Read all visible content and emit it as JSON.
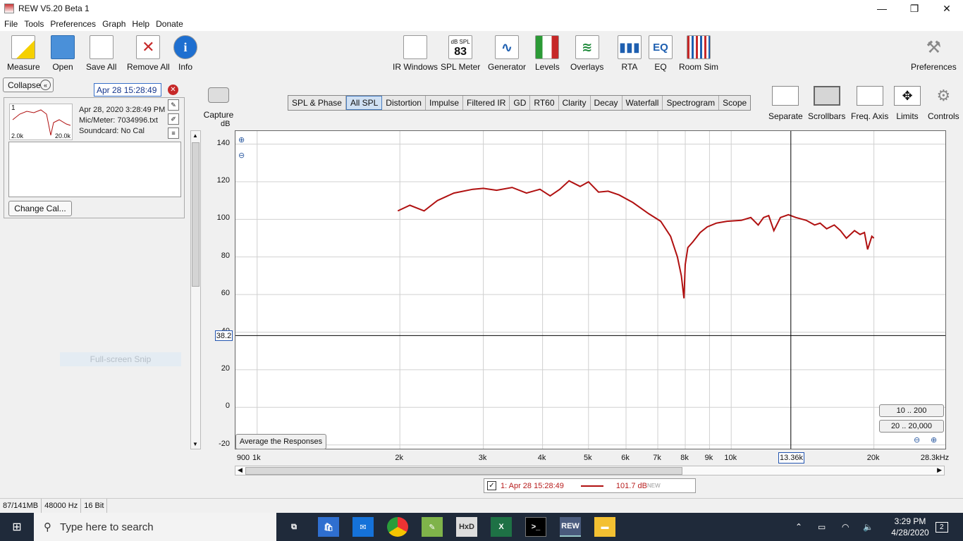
{
  "window": {
    "title": "REW V5.20 Beta 1",
    "minimize": "—",
    "maximize": "❐",
    "close": "✕"
  },
  "menu": [
    "File",
    "Tools",
    "Preferences",
    "Graph",
    "Help",
    "Donate"
  ],
  "toolbar_left": [
    "Measure",
    "Open",
    "Save All",
    "Remove All",
    "Info"
  ],
  "toolbar_center": [
    {
      "label": "IR Windows",
      "icon": "ir-windows-icon"
    },
    {
      "label": "SPL Meter",
      "icon": "spl-meter-icon",
      "badge_top": "dB SPL",
      "badge_value": "83"
    },
    {
      "label": "Generator",
      "icon": "generator-icon"
    },
    {
      "label": "Levels",
      "icon": "levels-icon"
    },
    {
      "label": "Overlays",
      "icon": "overlays-icon"
    },
    {
      "label": "RTA",
      "icon": "rta-icon"
    },
    {
      "label": "EQ",
      "icon": "eq-icon"
    },
    {
      "label": "Room Sim",
      "icon": "room-sim-icon"
    }
  ],
  "toolbar_right": "Preferences",
  "left_panel": {
    "collapse_label": "Collapse",
    "measurement_name": "Apr 28 15:28:49",
    "thumb_number": "1",
    "thumb_lo": "2.0k",
    "thumb_hi": "20.0k",
    "date": "Apr 28, 2020 3:28:49 PM",
    "mic": "Mic/Meter: 7034996.txt",
    "soundcard": "Soundcard: No Cal",
    "change_cal": "Change Cal...",
    "snip_text": "Full-screen Snip"
  },
  "capture_label": "Capture",
  "graph_tabs": [
    "SPL & Phase",
    "All SPL",
    "Distortion",
    "Impulse",
    "Filtered IR",
    "GD",
    "RT60",
    "Clarity",
    "Decay",
    "Waterfall",
    "Spectrogram",
    "Scope"
  ],
  "active_tab": "All SPL",
  "graph_tools": [
    "Separate",
    "Scrollbars",
    "Freq. Axis",
    "Limits",
    "Controls"
  ],
  "graph": {
    "y_unit": "dB",
    "cursor_x": "13.36k",
    "cursor_y": "38.2",
    "average_button": "Average the Responses",
    "range_buttons": [
      "10 .. 200",
      "20 .. 20,000"
    ]
  },
  "legend": {
    "label": "1: Apr 28 15:28:49",
    "value": "101.7 dB",
    "tag": "NEW",
    "check": "✓"
  },
  "status": [
    "87/141MB",
    "48000 Hz",
    "16 Bit"
  ],
  "taskbar": {
    "search_placeholder": "Type here to search",
    "time": "3:29 PM",
    "date": "4/28/2020",
    "notifications": "2",
    "apps": [
      "task-view",
      "store",
      "mail",
      "chrome",
      "notepad",
      "hxd",
      "excel",
      "terminal",
      "rew",
      "explorer"
    ]
  },
  "chart_data": {
    "type": "line",
    "title": "",
    "xlabel": "",
    "ylabel": "dB",
    "x_scale": "log",
    "xlim": [
      900,
      28300
    ],
    "ylim": [
      -20,
      140
    ],
    "x_ticks": [
      "900",
      "1k",
      "2k",
      "3k",
      "4k",
      "5k",
      "6k",
      "7k",
      "8k",
      "9k",
      "10k",
      "13.36k",
      "20k",
      "28.3kHz"
    ],
    "y_ticks": [
      "140",
      "120",
      "100",
      "80",
      "60",
      "40",
      "20",
      "0",
      "-20"
    ],
    "grid": true,
    "series": [
      {
        "name": "1: Apr 28 15:28:49",
        "color": "#b01010",
        "x": [
          1980,
          2100,
          2250,
          2400,
          2600,
          2850,
          3000,
          3200,
          3450,
          3700,
          3950,
          4150,
          4350,
          4550,
          4800,
          5000,
          5250,
          5500,
          5800,
          6200,
          6700,
          7100,
          7450,
          7700,
          7850,
          7950,
          8000,
          8100,
          8300,
          8600,
          8900,
          9300,
          9800,
          10500,
          11000,
          11400,
          11700,
          12000,
          12300,
          12700,
          13200,
          13700,
          14400,
          15000,
          15400,
          15900,
          16500,
          17000,
          17500,
          18200,
          18700,
          19100,
          19400,
          19800,
          20000
        ],
        "y": [
          104.5,
          107.5,
          104.5,
          110,
          114,
          116,
          116.5,
          115.5,
          117,
          114,
          116,
          112.5,
          116,
          120.5,
          117.5,
          120,
          114.5,
          115,
          113,
          109,
          103,
          99,
          91,
          80,
          70,
          58,
          76,
          85,
          88,
          93,
          96,
          98,
          99,
          99.5,
          101,
          97,
          101,
          102,
          94,
          101,
          102.5,
          101,
          99.5,
          97,
          98,
          95,
          97,
          94,
          90,
          94,
          92,
          93,
          84,
          91,
          90
        ]
      }
    ]
  }
}
